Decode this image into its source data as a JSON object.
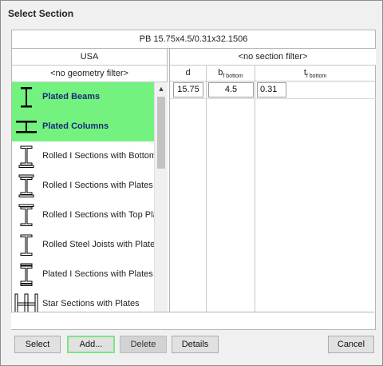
{
  "window": {
    "title": "Select Section"
  },
  "section_name": "PB 15.75x4.5/0.31x32.1506",
  "left": {
    "region": "USA",
    "geometry_filter": "<no geometry filter>",
    "items": [
      {
        "label": "Plated Beams",
        "icon": "plated-beam-icon",
        "selected": true
      },
      {
        "label": "Plated Columns",
        "icon": "plated-column-icon",
        "selected": true
      },
      {
        "label": "Rolled I Sections with Bottom Plate",
        "icon": "i-section-bottom-plate-icon",
        "selected": false
      },
      {
        "label": "Rolled I Sections with Plates",
        "icon": "i-section-plates-icon",
        "selected": false
      },
      {
        "label": "Rolled I Sections with Top Plate",
        "icon": "i-section-top-plate-icon",
        "selected": false
      },
      {
        "label": "Rolled Steel Joists with Plates",
        "icon": "steel-joist-plates-icon",
        "selected": false
      },
      {
        "label": "Plated I Sections with Plates",
        "icon": "plated-i-section-icon",
        "selected": false
      },
      {
        "label": "Star Sections with Plates",
        "icon": "star-section-icon",
        "selected": false
      }
    ]
  },
  "right": {
    "section_filter": "<no section filter>",
    "columns": [
      {
        "name": "d",
        "sub": ""
      },
      {
        "name": "b",
        "sub": "f bottom"
      },
      {
        "name": "t",
        "sub": "f bottom"
      }
    ],
    "values": [
      "15.75",
      "4.5",
      "0.31"
    ]
  },
  "buttons": {
    "select": "Select",
    "add": "Add...",
    "delete": "Delete",
    "details": "Details",
    "cancel": "Cancel"
  }
}
